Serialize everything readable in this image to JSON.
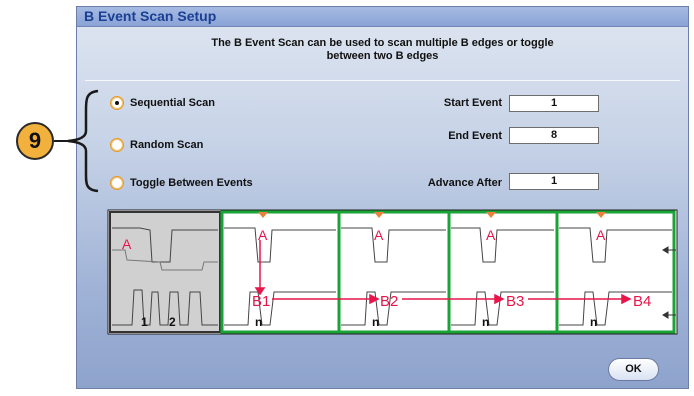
{
  "callout": {
    "number": "9"
  },
  "dialog": {
    "title": "B Event Scan Setup",
    "description_line1": "The B Event Scan can be used to scan multiple B edges or toggle",
    "description_line2": "between two B edges",
    "scan_modes": [
      {
        "label": "Sequential Scan",
        "selected": true
      },
      {
        "label": "Random Scan",
        "selected": false
      },
      {
        "label": "Toggle Between Events",
        "selected": false
      }
    ],
    "fields": {
      "start_event": {
        "label": "Start Event",
        "value": "1"
      },
      "end_event": {
        "label": "End Event",
        "value": "8"
      },
      "advance_after": {
        "label": "Advance After",
        "value": "1"
      }
    },
    "ok_label": "OK"
  },
  "diagram": {
    "preview_labels": {
      "a": "A",
      "one": "1",
      "two": "2"
    },
    "segment_labels": {
      "a": "A",
      "n": "n"
    },
    "b_labels": [
      "B1",
      "B2",
      "B3",
      "B4"
    ],
    "colors": {
      "accent": "#e8154a",
      "frame": "#1aa336",
      "marker": "#e8823a",
      "preview_bg": "#d0d0d0"
    }
  }
}
